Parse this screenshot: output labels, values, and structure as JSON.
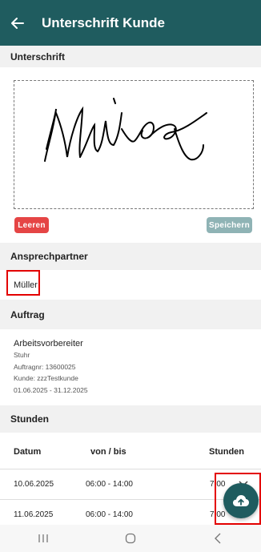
{
  "header": {
    "title": "Unterschrift Kunde",
    "back_icon": "arrow-left-icon"
  },
  "signature": {
    "section_label": "Unterschrift",
    "clear_label": "Leeren",
    "save_label": "Speichern"
  },
  "contact": {
    "section_label": "Ansprechpartner",
    "name": "Müller"
  },
  "order": {
    "section_label": "Auftrag",
    "title": "Arbeitsvorbereiter",
    "location": "Stuhr",
    "order_number": "Auftragnr: 13600025",
    "customer": "Kunde: zzzTestkunde",
    "period": "01.06.2025 - 31.12.2025"
  },
  "hours": {
    "section_label": "Stunden",
    "columns": [
      "Datum",
      "von / bis",
      "Stunden"
    ],
    "rows": [
      {
        "date": "10.06.2025",
        "time": "06:00 - 14:00",
        "hours": "7,00"
      },
      {
        "date": "11.06.2025",
        "time": "06:00 - 14:00",
        "hours": "7,00"
      }
    ]
  },
  "colors": {
    "primary": "#1f5c5f",
    "danger": "#e54545",
    "disabled": "#8fb3b5",
    "highlight": "#e30000"
  },
  "nav": {
    "recent_icon": "recent-apps-icon",
    "home_icon": "home-icon",
    "back_icon": "nav-back-icon"
  },
  "fab": {
    "icon": "cloud-upload-icon"
  }
}
